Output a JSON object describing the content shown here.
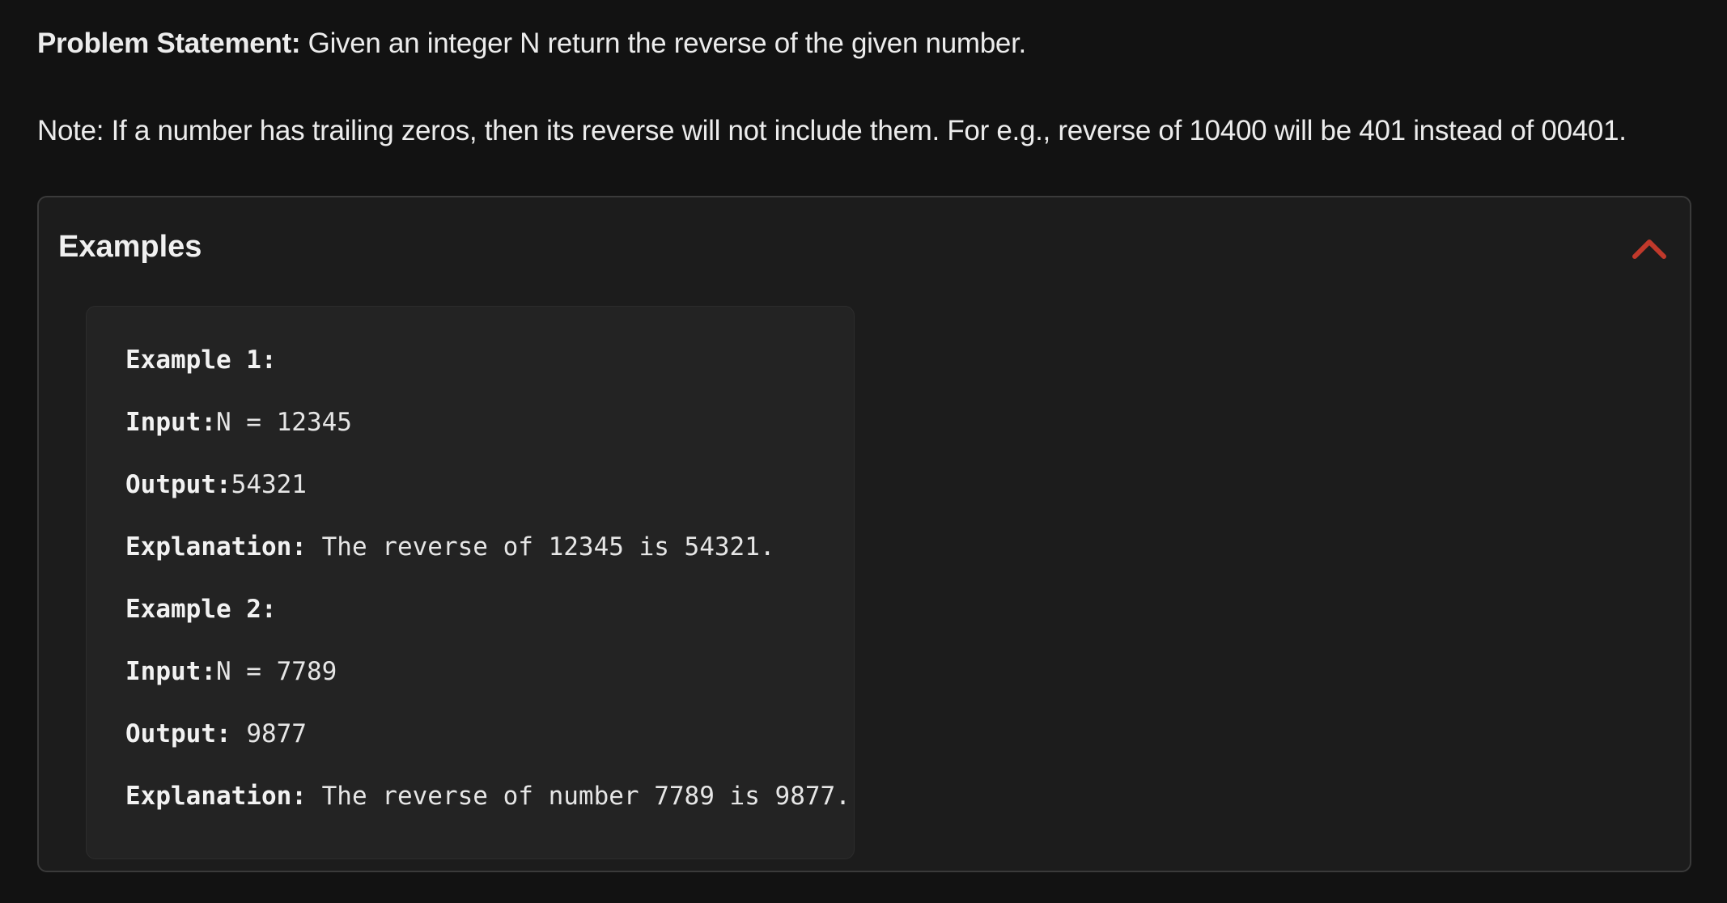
{
  "problem": {
    "label": "Problem Statement:",
    "text": " Given an integer N return the reverse of the given number."
  },
  "note": {
    "text": "Note: If a number has trailing zeros, then its reverse will not include them. For e.g., reverse of 10400 will be 401 instead of 00401."
  },
  "examples": {
    "title": "Examples",
    "collapse_icon": "chevron-up-icon",
    "accent_color": "#c0392b",
    "items": [
      {
        "heading": "Example 1:",
        "input_label": "Input:",
        "input_value": "N = 12345",
        "output_label": "Output:",
        "output_value": "54321",
        "explanation_label": "Explanation:",
        "explanation_value": " The reverse of 12345 is 54321."
      },
      {
        "heading": "Example 2:",
        "input_label": "Input:",
        "input_value": "N = 7789",
        "output_label": "Output:",
        "output_value": " 9877",
        "explanation_label": "Explanation:",
        "explanation_value": " The reverse of number 7789 is 9877."
      }
    ]
  }
}
